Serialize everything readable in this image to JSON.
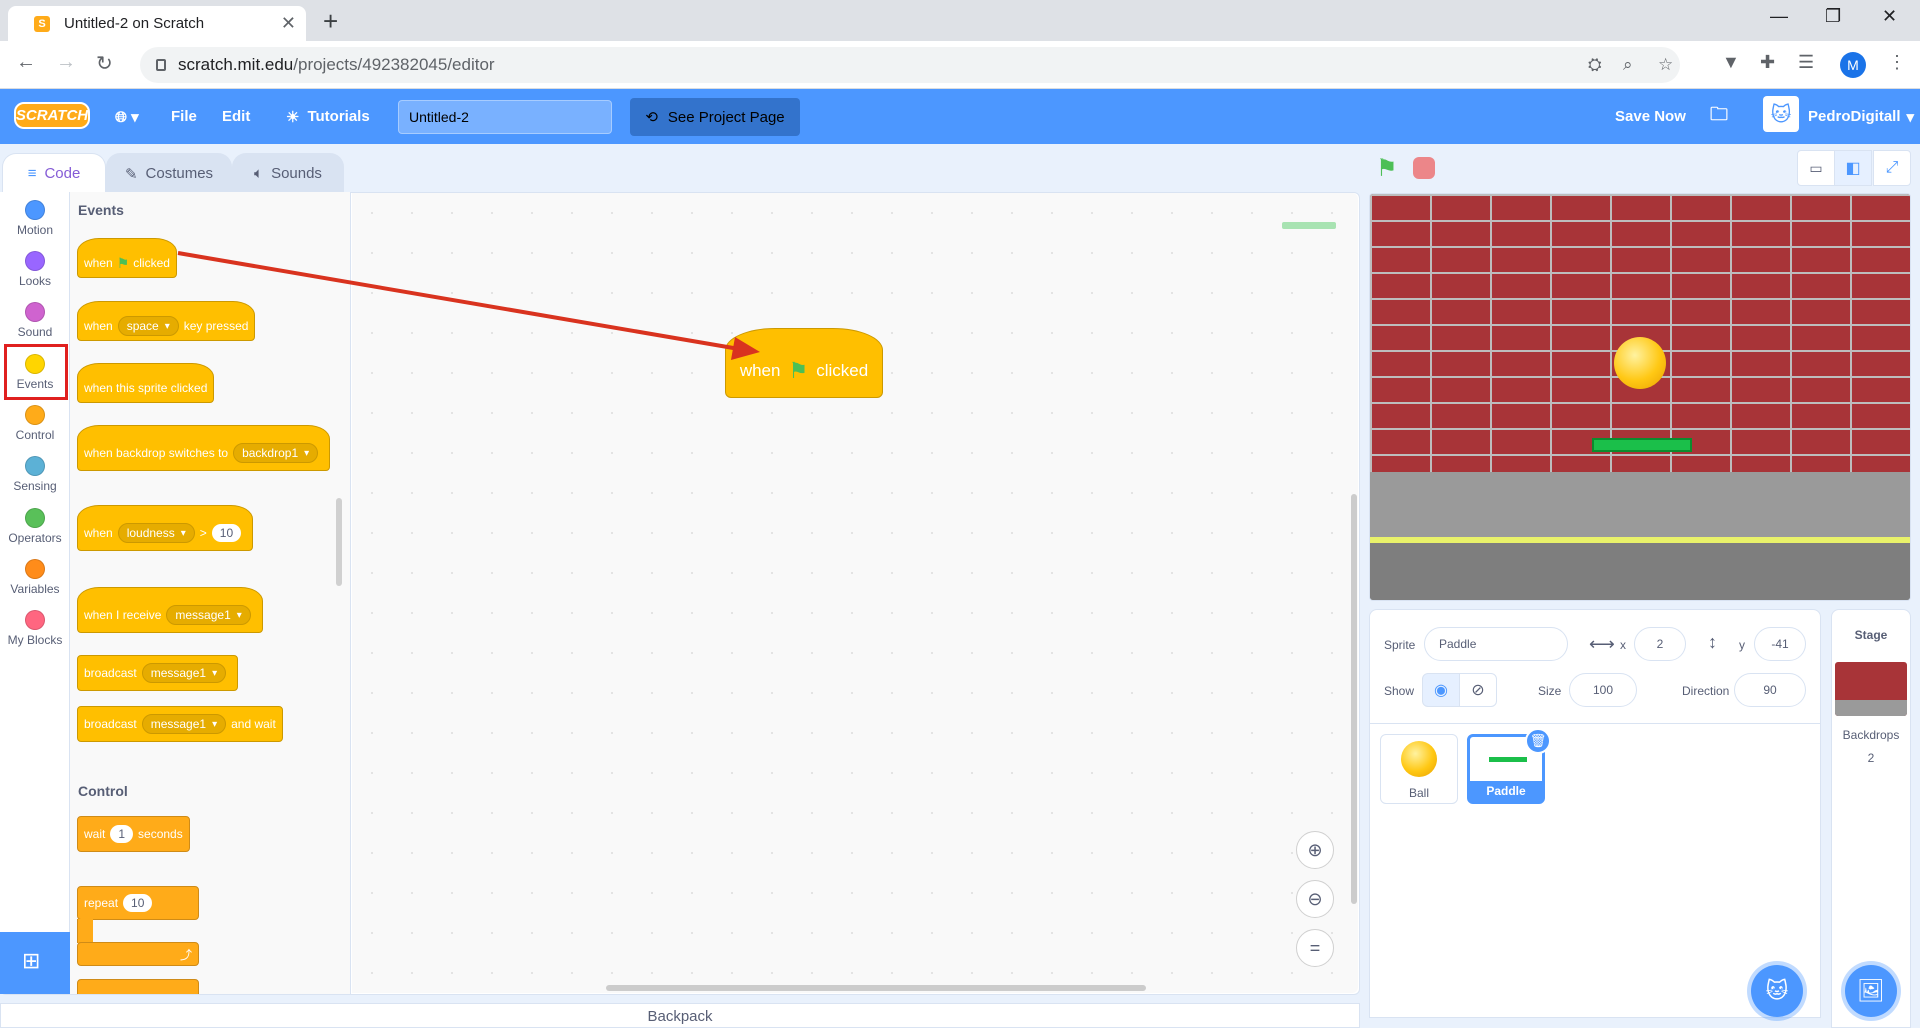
{
  "browser": {
    "tab_title": "Untitled-2 on Scratch",
    "url_host": "scratch.mit.edu",
    "url_path": "/projects/492382045/editor",
    "avatar_letter": "M"
  },
  "menubar": {
    "logo": "SCRATCH",
    "file": "File",
    "edit": "Edit",
    "tutorials": "Tutorials",
    "project_title": "Untitled-2",
    "see_project": "See Project Page",
    "save_now": "Save Now",
    "username": "PedroDigitall"
  },
  "editor_tabs": {
    "code": "Code",
    "costumes": "Costumes",
    "sounds": "Sounds"
  },
  "categories": [
    {
      "label": "Motion",
      "color": "#4c97ff"
    },
    {
      "label": "Looks",
      "color": "#9966ff"
    },
    {
      "label": "Sound",
      "color": "#cf63cf"
    },
    {
      "label": "Events",
      "color": "#ffd500"
    },
    {
      "label": "Control",
      "color": "#ffab19"
    },
    {
      "label": "Sensing",
      "color": "#5cb1d6"
    },
    {
      "label": "Operators",
      "color": "#59c059"
    },
    {
      "label": "Variables",
      "color": "#ff8c1a"
    },
    {
      "label": "My Blocks",
      "color": "#ff6680"
    }
  ],
  "palette": {
    "events_heading": "Events",
    "control_heading": "Control",
    "when": "when",
    "clicked": "clicked",
    "key_option": "space",
    "key_pressed": "key pressed",
    "sprite_clicked": "when this sprite clicked",
    "backdrop_switches": "when backdrop switches to",
    "backdrop_option": "backdrop1",
    "loudness_option": "loudness",
    "gt": ">",
    "loudness_value": "10",
    "receive": "when I receive",
    "message_option": "message1",
    "broadcast": "broadcast",
    "and_wait": "and wait",
    "wait": "wait",
    "wait_value": "1",
    "seconds": "seconds",
    "repeat": "repeat",
    "repeat_value": "10"
  },
  "workspace": {
    "block_when": "when",
    "block_clicked": "clicked"
  },
  "backpack": "Backpack",
  "sprite_info": {
    "sprite_label": "Sprite",
    "sprite_name": "Paddle",
    "x_label": "x",
    "x_value": "2",
    "y_label": "y",
    "y_value": "-41",
    "show_label": "Show",
    "size_label": "Size",
    "size_value": "100",
    "direction_label": "Direction",
    "direction_value": "90"
  },
  "sprites": [
    {
      "name": "Ball",
      "selected": false
    },
    {
      "name": "Paddle",
      "selected": true
    }
  ],
  "stage_panel": {
    "title": "Stage",
    "backdrops_label": "Backdrops",
    "backdrops_count": "2"
  }
}
